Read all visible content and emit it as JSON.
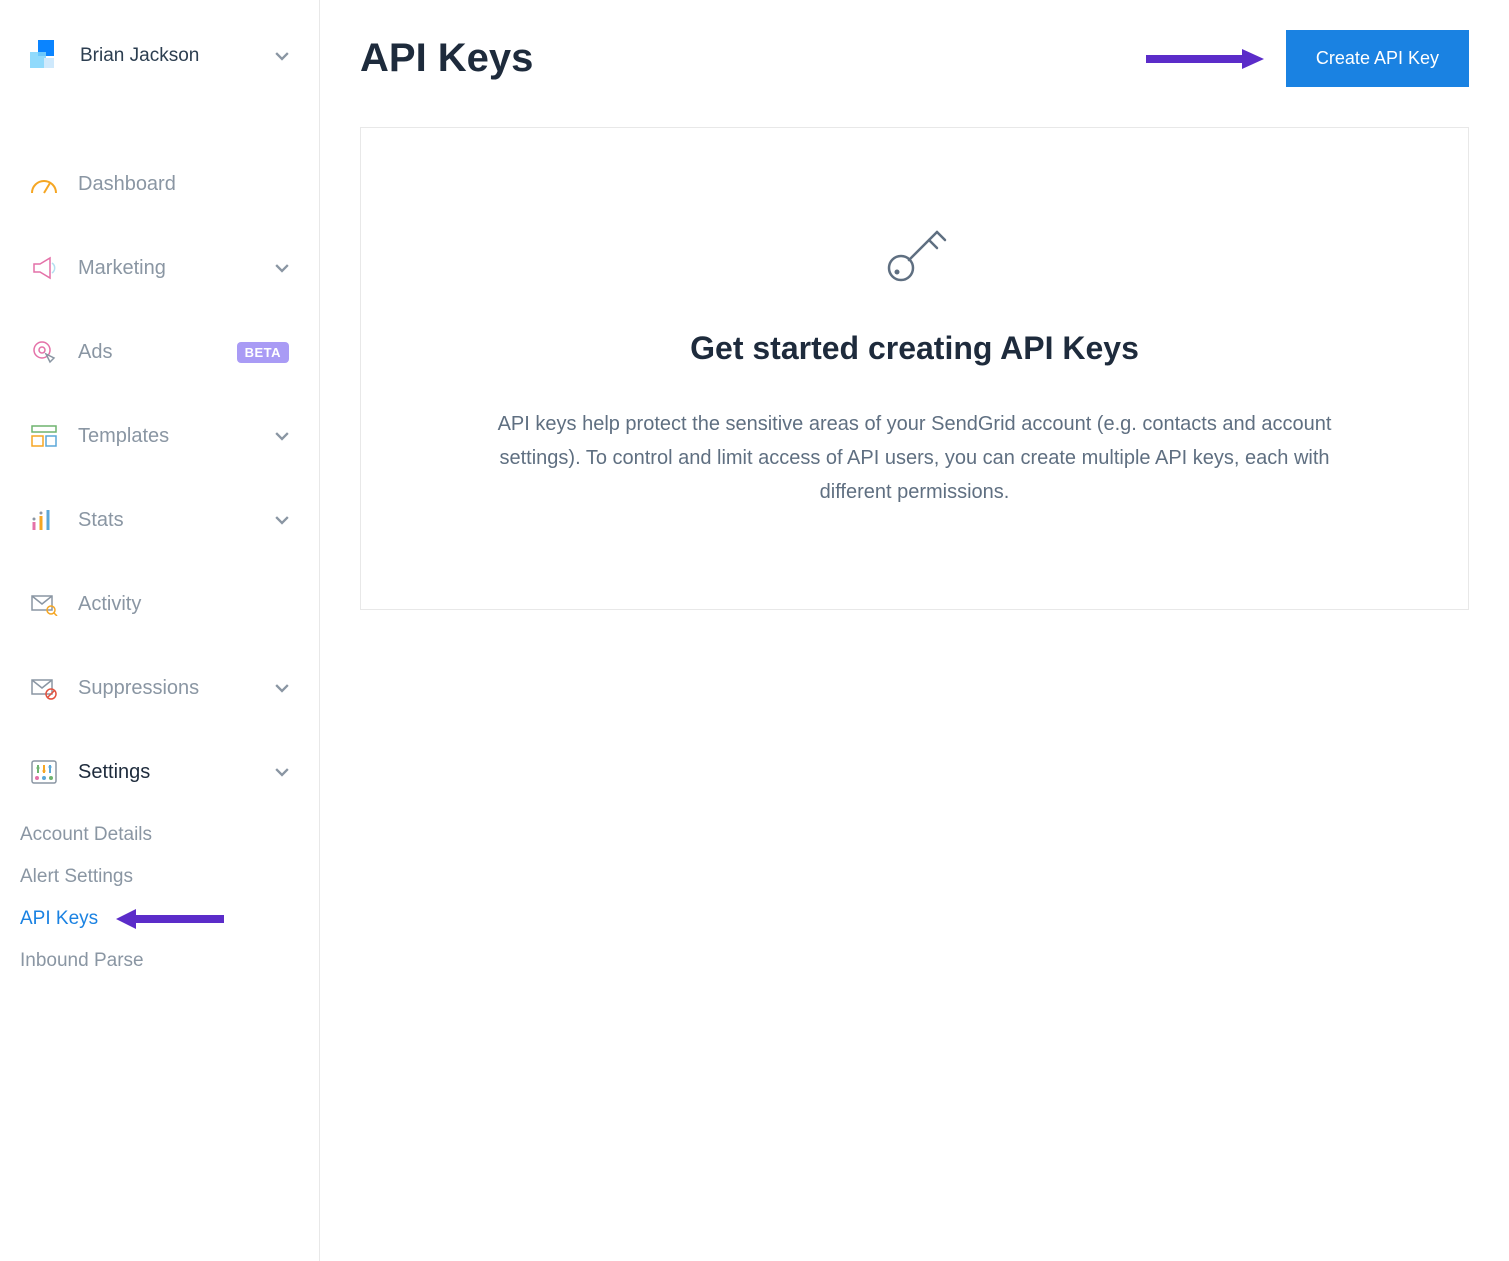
{
  "user": {
    "name": "Brian Jackson"
  },
  "sidebar": {
    "items": [
      {
        "label": "Dashboard"
      },
      {
        "label": "Marketing"
      },
      {
        "label": "Ads",
        "badge": "BETA"
      },
      {
        "label": "Templates"
      },
      {
        "label": "Stats"
      },
      {
        "label": "Activity"
      },
      {
        "label": "Suppressions"
      },
      {
        "label": "Settings"
      }
    ],
    "settings_sub": [
      {
        "label": "Account Details"
      },
      {
        "label": "Alert Settings"
      },
      {
        "label": "API Keys"
      },
      {
        "label": "Inbound Parse"
      }
    ]
  },
  "page": {
    "title": "API Keys",
    "create_button": "Create API Key"
  },
  "card": {
    "title": "Get started creating API Keys",
    "description": "API keys help protect the sensitive areas of your SendGrid account (e.g. contacts and account settings). To control and limit access of API users, you can create multiple API keys, each with different permissions."
  },
  "colors": {
    "primary_blue": "#1a82e2",
    "annotation_purple": "#5b2cc9",
    "text_dark": "#1e2b3c",
    "text_muted": "#8a96a3"
  }
}
